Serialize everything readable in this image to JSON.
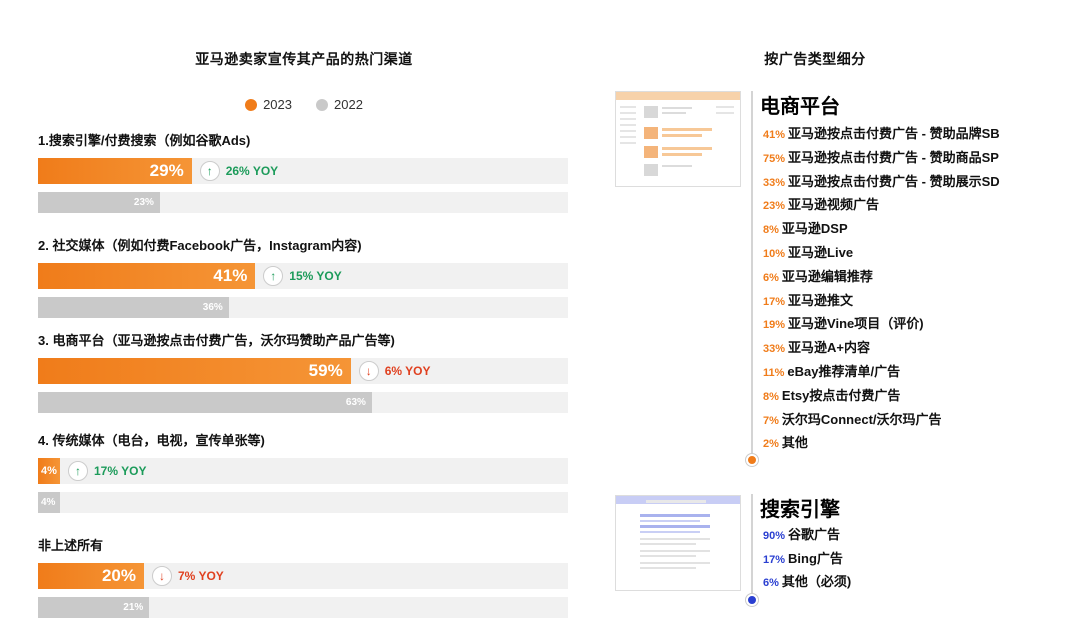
{
  "left": {
    "title": "亚马逊卖家宣传其产品的热门渠道",
    "legend": [
      {
        "label": "2023",
        "color": "#f07c1a"
      },
      {
        "label": "2022",
        "color": "#c9c9c9"
      }
    ]
  },
  "chart_data": {
    "type": "bar",
    "orientation": "horizontal",
    "xlim": [
      0,
      100
    ],
    "categories": [
      "1.搜索引擎/付费搜索（例如谷歌Ads)",
      "2. 社交媒体（例如付费Facebook广告，Instagram内容)",
      "3. 电商平台（亚马逊按点击付费广告，沃尔玛赞助产品广告等)",
      "4. 传统媒体（电台，电视，宣传单张等)",
      "非上述所有"
    ],
    "series": [
      {
        "name": "2023",
        "values": [
          29,
          41,
          59,
          4,
          20
        ],
        "labels": [
          "29%",
          "41%",
          "59%",
          "4%",
          "20%"
        ],
        "color": "#f07c1a"
      },
      {
        "name": "2022",
        "values": [
          23,
          36,
          63,
          4,
          21
        ],
        "labels": [
          "23%",
          "36%",
          "63%",
          "4%",
          "21%"
        ],
        "color": "#c9c9c9"
      }
    ],
    "yoy": [
      {
        "text": "26% YOY",
        "direction": "up"
      },
      {
        "text": "15% YOY",
        "direction": "up"
      },
      {
        "text": "6% YOY",
        "direction": "down"
      },
      {
        "text": "17% YOY",
        "direction": "up"
      },
      {
        "text": "7% YOY",
        "direction": "down"
      }
    ]
  },
  "right": {
    "title": "按广告类型细分",
    "colors": {
      "up": "#1c9b5a",
      "down": "#e0401f",
      "ecommerce": "#f07c1a",
      "search": "#2a3fd1"
    },
    "sections": [
      {
        "title": "电商平台",
        "color": "#f07c1a",
        "items": [
          {
            "pct": "41%",
            "label": "亚马逊按点击付费广告 - 赞助品牌SB"
          },
          {
            "pct": "75%",
            "label": "亚马逊按点击付费广告 - 赞助商品SP"
          },
          {
            "pct": "33%",
            "label": "亚马逊按点击付费广告 - 赞助展示SD"
          },
          {
            "pct": "23%",
            "label": "亚马逊视频广告"
          },
          {
            "pct": "8%",
            "label": "亚马逊DSP"
          },
          {
            "pct": "10%",
            "label": "亚马逊Live"
          },
          {
            "pct": "6%",
            "label": "亚马逊编辑推荐"
          },
          {
            "pct": "17%",
            "label": "亚马逊推文"
          },
          {
            "pct": "19%",
            "label": "亚马逊Vine项目（评价)"
          },
          {
            "pct": "33%",
            "label": "亚马逊A+内容"
          },
          {
            "pct": "11%",
            "label": "eBay推荐清单/广告"
          },
          {
            "pct": "8%",
            "label": "Etsy按点击付费广告"
          },
          {
            "pct": "7%",
            "label": "沃尔玛Connect/沃尔玛广告"
          },
          {
            "pct": "2%",
            "label": "其他"
          }
        ]
      },
      {
        "title": "搜索引擎",
        "color": "#2a3fd1",
        "items": [
          {
            "pct": "90%",
            "label": "谷歌广告"
          },
          {
            "pct": "17%",
            "label": "Bing广告"
          },
          {
            "pct": "6%",
            "label": "其他（必须)"
          }
        ]
      }
    ]
  }
}
